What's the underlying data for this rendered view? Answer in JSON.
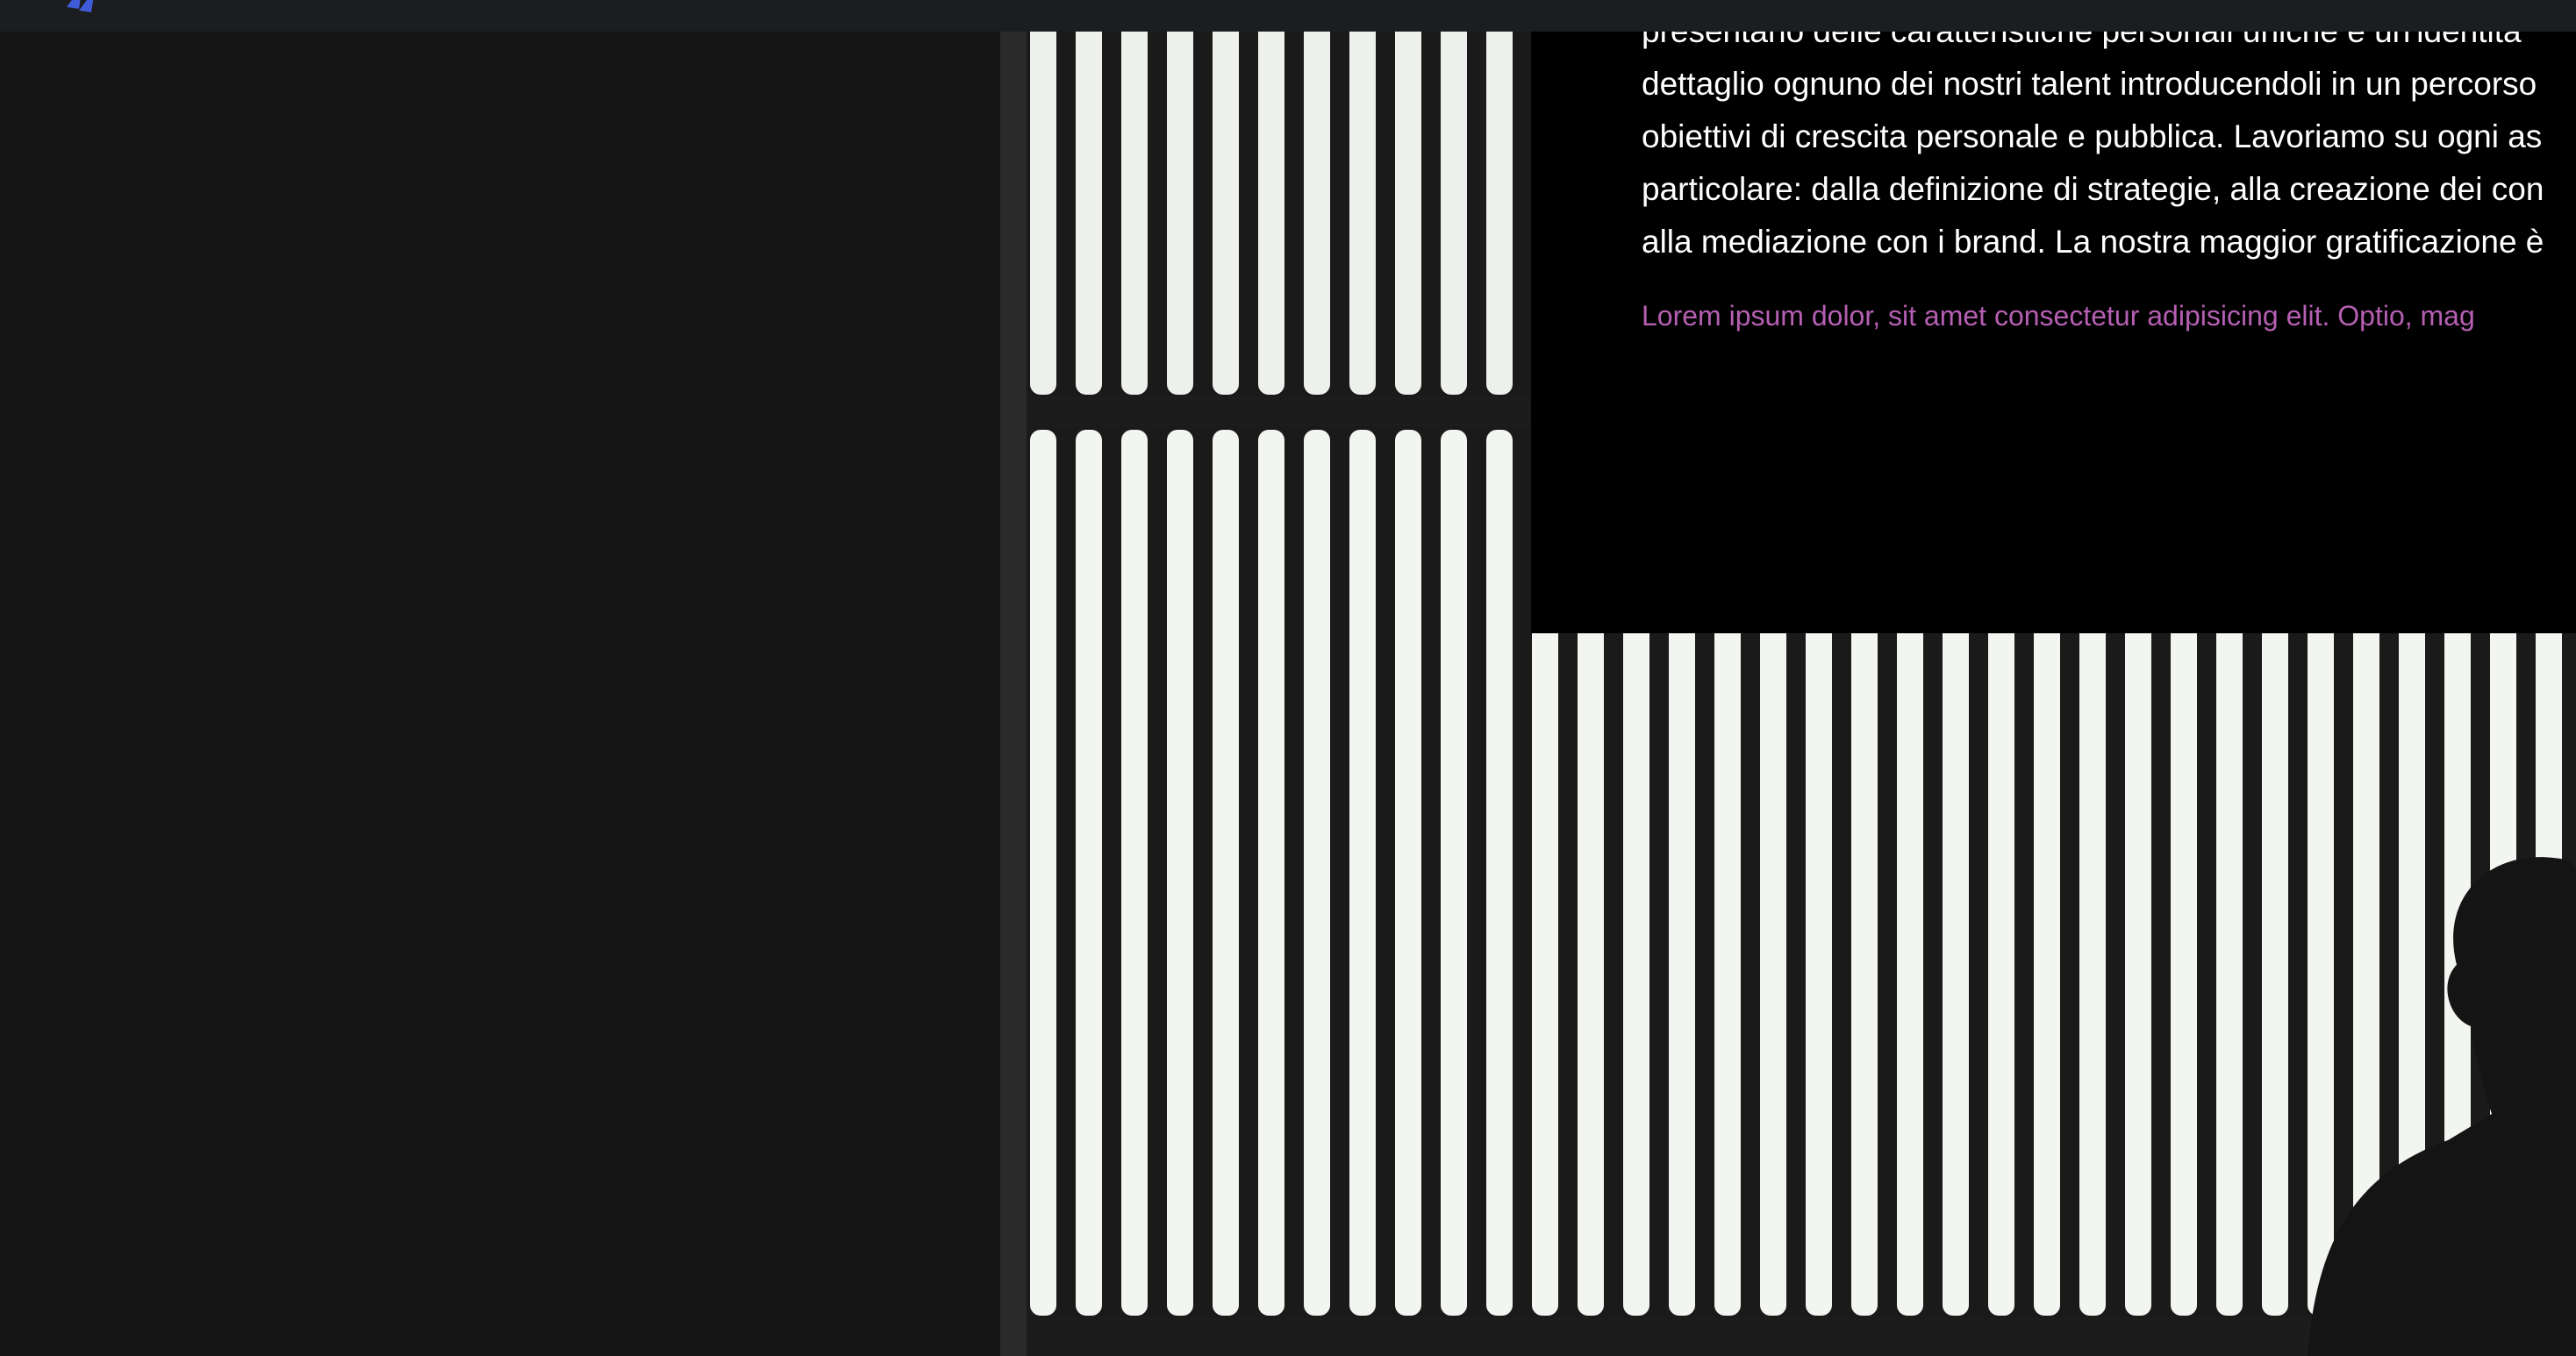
{
  "header": {
    "logo_icon": "chevron-logo-icon",
    "background": "#1c1d1f",
    "accent": "#3f5bd8"
  },
  "about": {
    "paragraph_lines": [
      "presentano delle caratteristiche personali uniche e un'identità",
      "dettaglio ognuno dei nostri talent introducendoli in un percorso",
      "obiettivi di crescita personale e pubblica. Lavoriamo su ogni as",
      "particolare: dalla definizione di strategie, alla creazione dei con",
      "alla mediazione con i brand. La nostra maggior gratificazione è"
    ],
    "lorem": "Lorem ipsum dolor, sit amet consectetur adipisicing elit. Optio, mag",
    "lorem_color": "#b55fb2"
  },
  "image": {
    "subject": "silhouette-person-striped-light-wall"
  }
}
